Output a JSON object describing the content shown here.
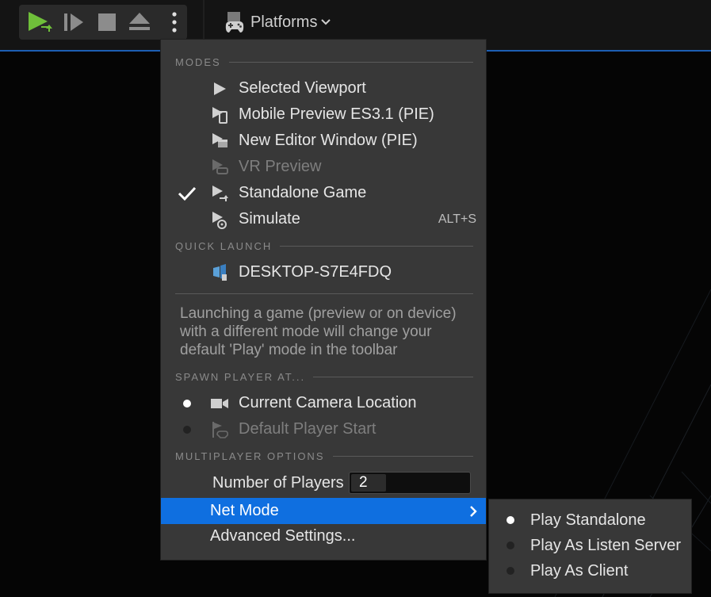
{
  "toolbar": {
    "platforms_label": "Platforms"
  },
  "menu": {
    "modes_header": "MODES",
    "modes": [
      {
        "label": "Selected Viewport",
        "checked": false,
        "disabled": false,
        "icon": "play-icon"
      },
      {
        "label": "Mobile Preview ES3.1 (PIE)",
        "checked": false,
        "disabled": false,
        "icon": "mobile-preview-icon"
      },
      {
        "label": "New Editor Window (PIE)",
        "checked": false,
        "disabled": false,
        "icon": "editor-window-icon"
      },
      {
        "label": "VR Preview",
        "checked": false,
        "disabled": true,
        "icon": "vr-preview-icon"
      },
      {
        "label": "Standalone Game",
        "checked": true,
        "disabled": false,
        "icon": "standalone-game-icon"
      },
      {
        "label": "Simulate",
        "checked": false,
        "disabled": false,
        "icon": "simulate-icon",
        "shortcut": "ALT+S"
      }
    ],
    "quick_launch_header": "QUICK LAUNCH",
    "device_label": "DESKTOP-S7E4FDQ",
    "note_text": "Launching a game (preview or on device) with a different mode will change your default 'Play' mode in the toolbar",
    "spawn_header": "SPAWN PLAYER AT...",
    "spawn_options": [
      {
        "label": "Current Camera Location",
        "selected": true,
        "disabled": false
      },
      {
        "label": "Default Player Start",
        "selected": false,
        "disabled": true
      }
    ],
    "multiplayer_header": "MULTIPLAYER OPTIONS",
    "players_label": "Number of Players",
    "players_value": "2",
    "net_mode_label": "Net Mode",
    "advanced_label": "Advanced Settings..."
  },
  "submenu": {
    "items": [
      {
        "label": "Play Standalone",
        "selected": true
      },
      {
        "label": "Play As Listen Server",
        "selected": false
      },
      {
        "label": "Play As Client",
        "selected": false
      }
    ]
  },
  "colors": {
    "accent": "#0f6fe0",
    "play_green": "#6fbf3a",
    "menu_bg": "#383838"
  }
}
